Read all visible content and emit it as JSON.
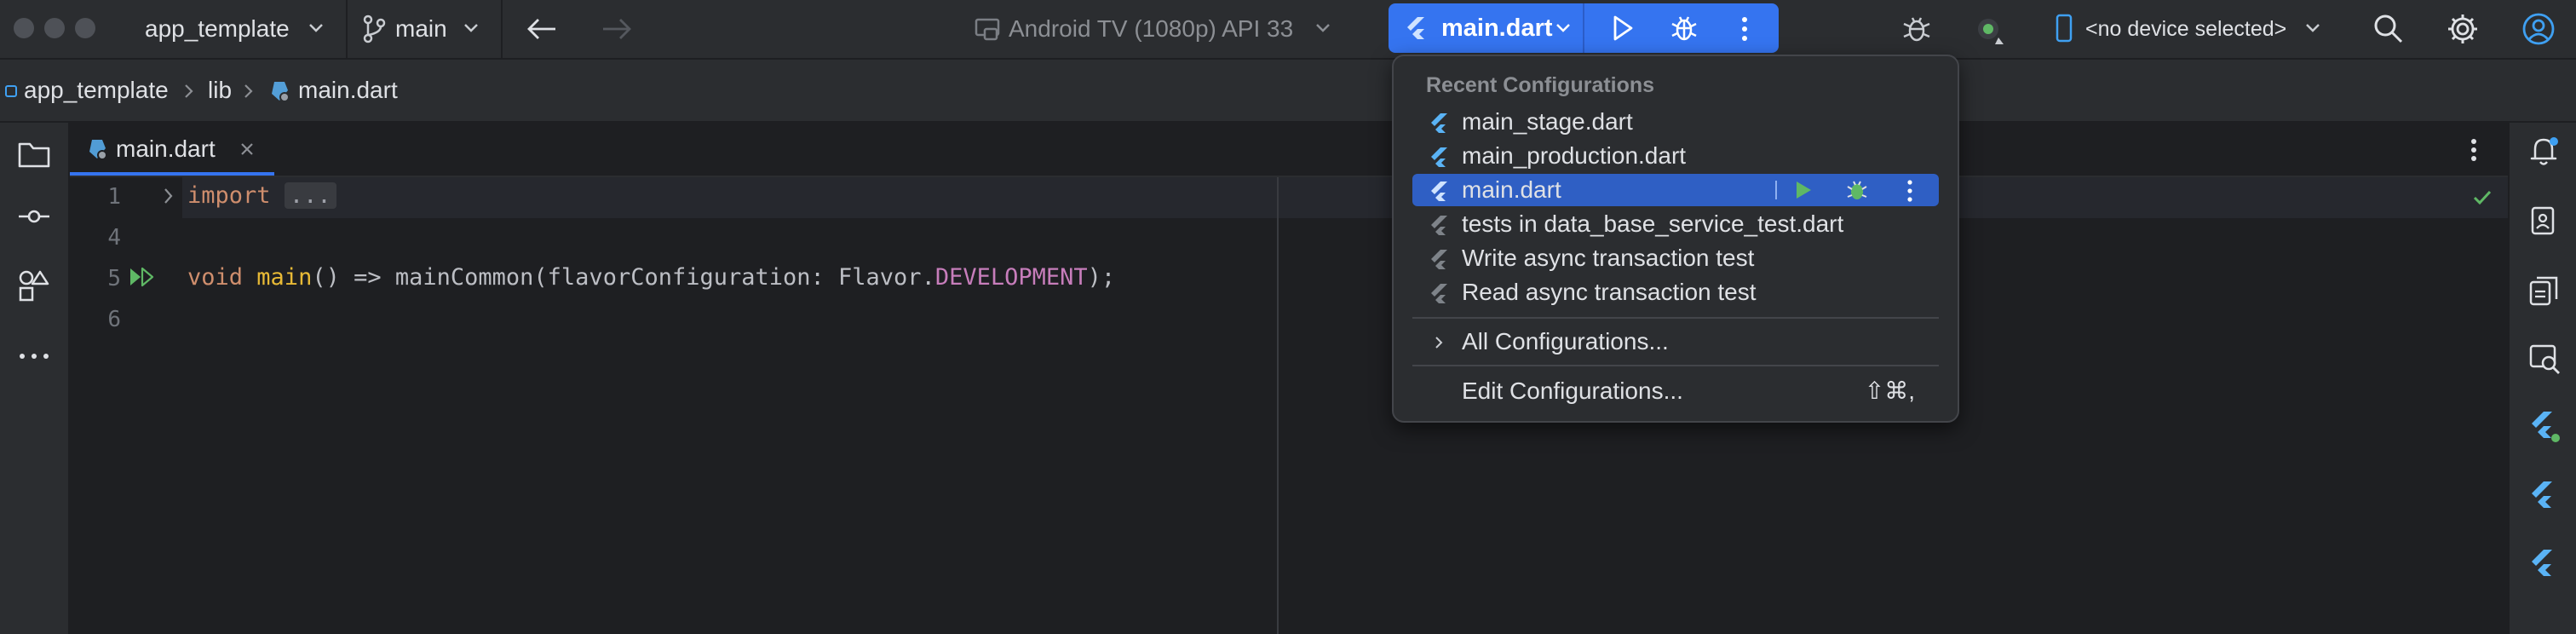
{
  "titlebar": {
    "project": "app_template",
    "branch": "main",
    "device_config": "Android TV (1080p) API 33",
    "run_config": "main.dart",
    "device_selector": "<no device selected>"
  },
  "breadcrumb": {
    "items": [
      "app_template",
      "lib",
      "main.dart"
    ]
  },
  "editor": {
    "tab": "main.dart",
    "lines": [
      {
        "num": "1"
      },
      {
        "num": "4"
      },
      {
        "num": "5"
      },
      {
        "num": "6"
      }
    ],
    "code": {
      "line1_kw": "import",
      "line1_fold": "...",
      "line5_void": "void",
      "line5_main": "main",
      "line5_rest1": "() => mainCommon(flavorConfiguration: Flavor.",
      "line5_const": "DEVELOPMENT",
      "line5_rest2": ");"
    }
  },
  "popup": {
    "header": "Recent Configurations",
    "items": [
      {
        "label": "main_stage.dart"
      },
      {
        "label": "main_production.dart"
      },
      {
        "label": "main.dart"
      },
      {
        "label": "tests in data_base_service_test.dart"
      },
      {
        "label": "Write async transaction test"
      },
      {
        "label": "Read async transaction test"
      }
    ],
    "all_configs": "All Configurations...",
    "edit_configs": "Edit Configurations...",
    "edit_shortcut": "⇧⌘,"
  },
  "colors": {
    "accent": "#3574f0",
    "background": "#1e1f22",
    "panel": "#2b2d30",
    "run_green": "#5fb865",
    "flutter_blue": "#5ab3f5"
  }
}
